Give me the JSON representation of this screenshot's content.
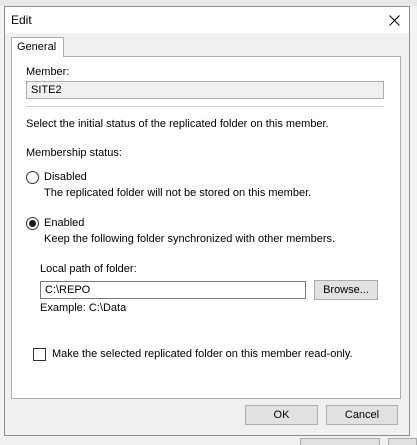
{
  "window": {
    "title": "Edit"
  },
  "tabs": [
    {
      "label": "General"
    }
  ],
  "member": {
    "label": "Member:",
    "value": "SITE2"
  },
  "instruction": "Select the initial status of the replicated folder on this member.",
  "membership_status": {
    "label": "Membership status:",
    "options": [
      {
        "label": "Disabled",
        "description": "The replicated folder will not be stored on this member.",
        "selected": false
      },
      {
        "label": "Enabled",
        "description": "Keep the following folder synchronized with other members.",
        "selected": true
      }
    ]
  },
  "local_path": {
    "label": "Local path of folder:",
    "value": "C:\\REPO",
    "browse_label": "Browse...",
    "example": "Example: C:\\Data"
  },
  "readonly_option": {
    "label": "Make the selected replicated folder on this member read-only.",
    "checked": false
  },
  "buttons": {
    "ok": "OK",
    "cancel": "Cancel"
  },
  "icons": {
    "close": "close-icon",
    "radio_selected": "radio-dot-icon"
  }
}
